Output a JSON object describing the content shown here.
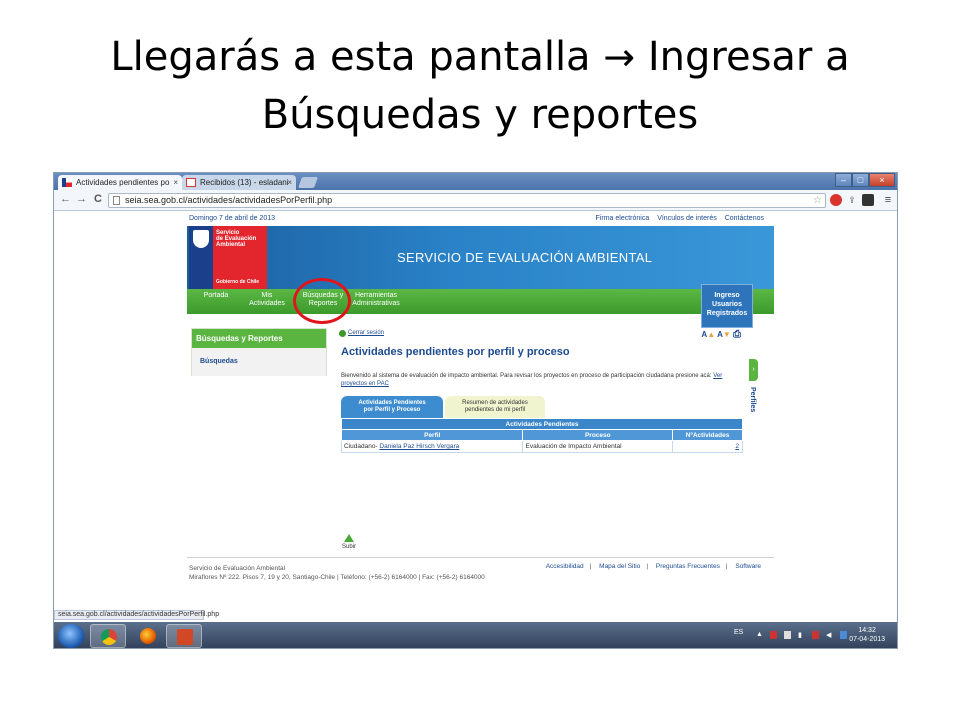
{
  "slide": {
    "title_line1": "Llegarás a esta pantalla",
    "arrow": "→",
    "title_line1_end": "Ingresar a",
    "title_line2": "Búsquedas y reportes"
  },
  "browser": {
    "tabs": [
      {
        "label": "Actividades pendientes po",
        "close": "×"
      },
      {
        "label": "Recibidos (13) - esladani",
        "close": "×"
      }
    ],
    "window": {
      "min": "–",
      "max": "□",
      "close": "×"
    },
    "nav": {
      "back": "←",
      "forward": "→",
      "reload": "C"
    },
    "url": "seia.sea.gob.cl/actividades/actividadesPorPerfil.php",
    "star": "☆",
    "status_url": "seia.sea.gob.cl/actividades/actividadesPorPerfil.php"
  },
  "site": {
    "date": "Domingo 7 de abril de 2013",
    "top_links": [
      "Firma electrónica",
      "Vínculos de interés",
      "Contáctenos"
    ],
    "logo_lines": [
      "Servicio",
      "de Evaluación",
      "Ambiental"
    ],
    "logo_gob": "Gobierno de Chile",
    "banner_title": "SERVICIO DE EVALUACIÓN AMBIENTAL",
    "menu": [
      {
        "line1": "Portada",
        "line2": ""
      },
      {
        "line1": "Mis",
        "line2": "Actividades"
      },
      {
        "line1": "Búsquedas y",
        "line2": "Reportes"
      },
      {
        "line1": "Herramientas",
        "line2": "Administrativas"
      }
    ],
    "ingreso": [
      "Ingreso",
      "Usuarios",
      "Registrados"
    ],
    "sidebar": {
      "header": "Búsquedas y Reportes",
      "item": "Búsquedas"
    },
    "cerrar_sesion": "Cerrar sesión",
    "tools": {
      "a_plus": "A",
      "a_minus": "A",
      "print": "⎙"
    },
    "page_title": "Actividades pendientes por perfil y proceso",
    "intro": "Bienvenido al sistema de evaluación de impacto ambiental. Para revisar los proyectos en proceso de participación ciudadana presione acá:",
    "intro_link": "Ver proyectos en PAC",
    "tab_on": [
      "Actividades Pendientes",
      "por Perfil y Proceso"
    ],
    "tab_off": [
      "Resumen de actividades",
      "pendientes de mi perfil"
    ],
    "table": {
      "caption": "Actividades Pendientes",
      "headers": [
        "Perfil",
        "Proceso",
        "NºActividades"
      ],
      "row": {
        "perfil_prefix": "Ciudadano-",
        "perfil_link": "Daniela Paz Hirsch Vergara",
        "proceso": "Evaluación de Impacto Ambiental",
        "n": "2"
      }
    },
    "subir": "Subir",
    "perfiles_tab": "›",
    "perfiles_label": "Perfiles",
    "footer": {
      "org": "Servicio de Evaluación Ambiental",
      "address": "Miraflores Nº 222. Pisos 7, 19 y 20, Santiago-Chile | Teléfono: (+56-2) 6164000 | Fax: (+56-2) 6164000",
      "links": [
        "Accesibilidad",
        "Mapa del Sitio",
        "Preguntas Frecuentes",
        "Software"
      ],
      "sep": "|"
    }
  },
  "taskbar": {
    "lang": "ES",
    "time": "14:32",
    "date": "07-04-2013"
  },
  "colors": {
    "menu_green": "#3c9a2c",
    "banner_blue": "#2a82c7",
    "highlight_red": "#e0151b"
  }
}
